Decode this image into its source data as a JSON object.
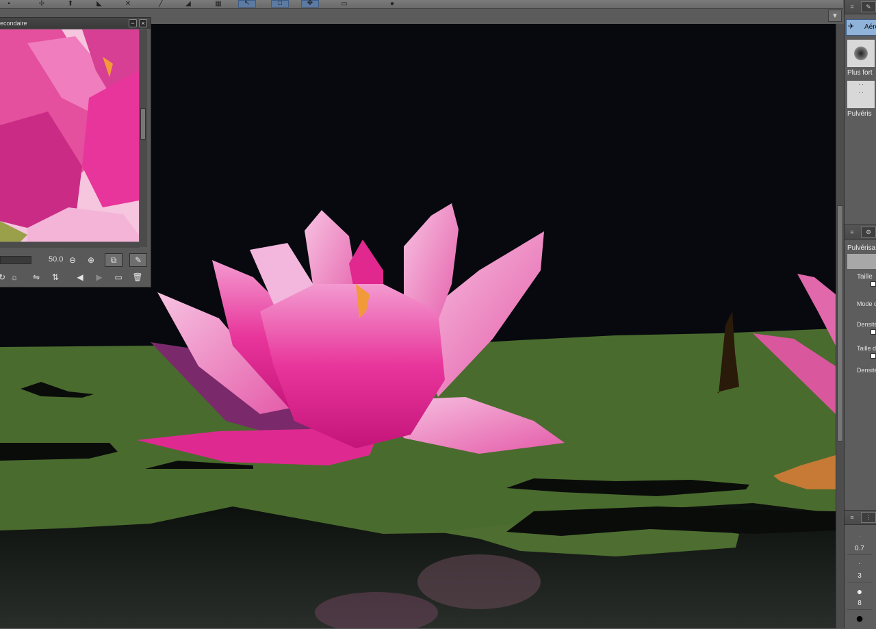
{
  "toolbar": {
    "buttons": [
      "operation-icon",
      "pen-icon",
      "move-icon",
      "transform-icon",
      "selection-icon",
      "layer-icon",
      "grid-icon",
      "pointer-icon",
      "frame-icon",
      "select-icon",
      "layer-move-icon",
      "info-icon"
    ]
  },
  "subview": {
    "title": "econdaire",
    "zoom_value": "50.0",
    "minimize_symbol": "−",
    "close_symbol": "×"
  },
  "panels": {
    "brush_tab": {
      "selected_label": "Aéro",
      "items": [
        "Plus fort",
        "Pulvéris"
      ]
    },
    "tool_property": {
      "title": "Pulvérisa",
      "properties": [
        "Taille",
        "Mode d",
        "Densité",
        "Taille d",
        "Densité"
      ]
    },
    "brush_size": {
      "values": [
        "0.7",
        "3",
        "8"
      ]
    }
  },
  "colors": {
    "canvas_bg": "#07090e",
    "leaf": "#4a6b2e",
    "lotus": "#e8359b",
    "panel_bg": "#5d5d5d"
  }
}
